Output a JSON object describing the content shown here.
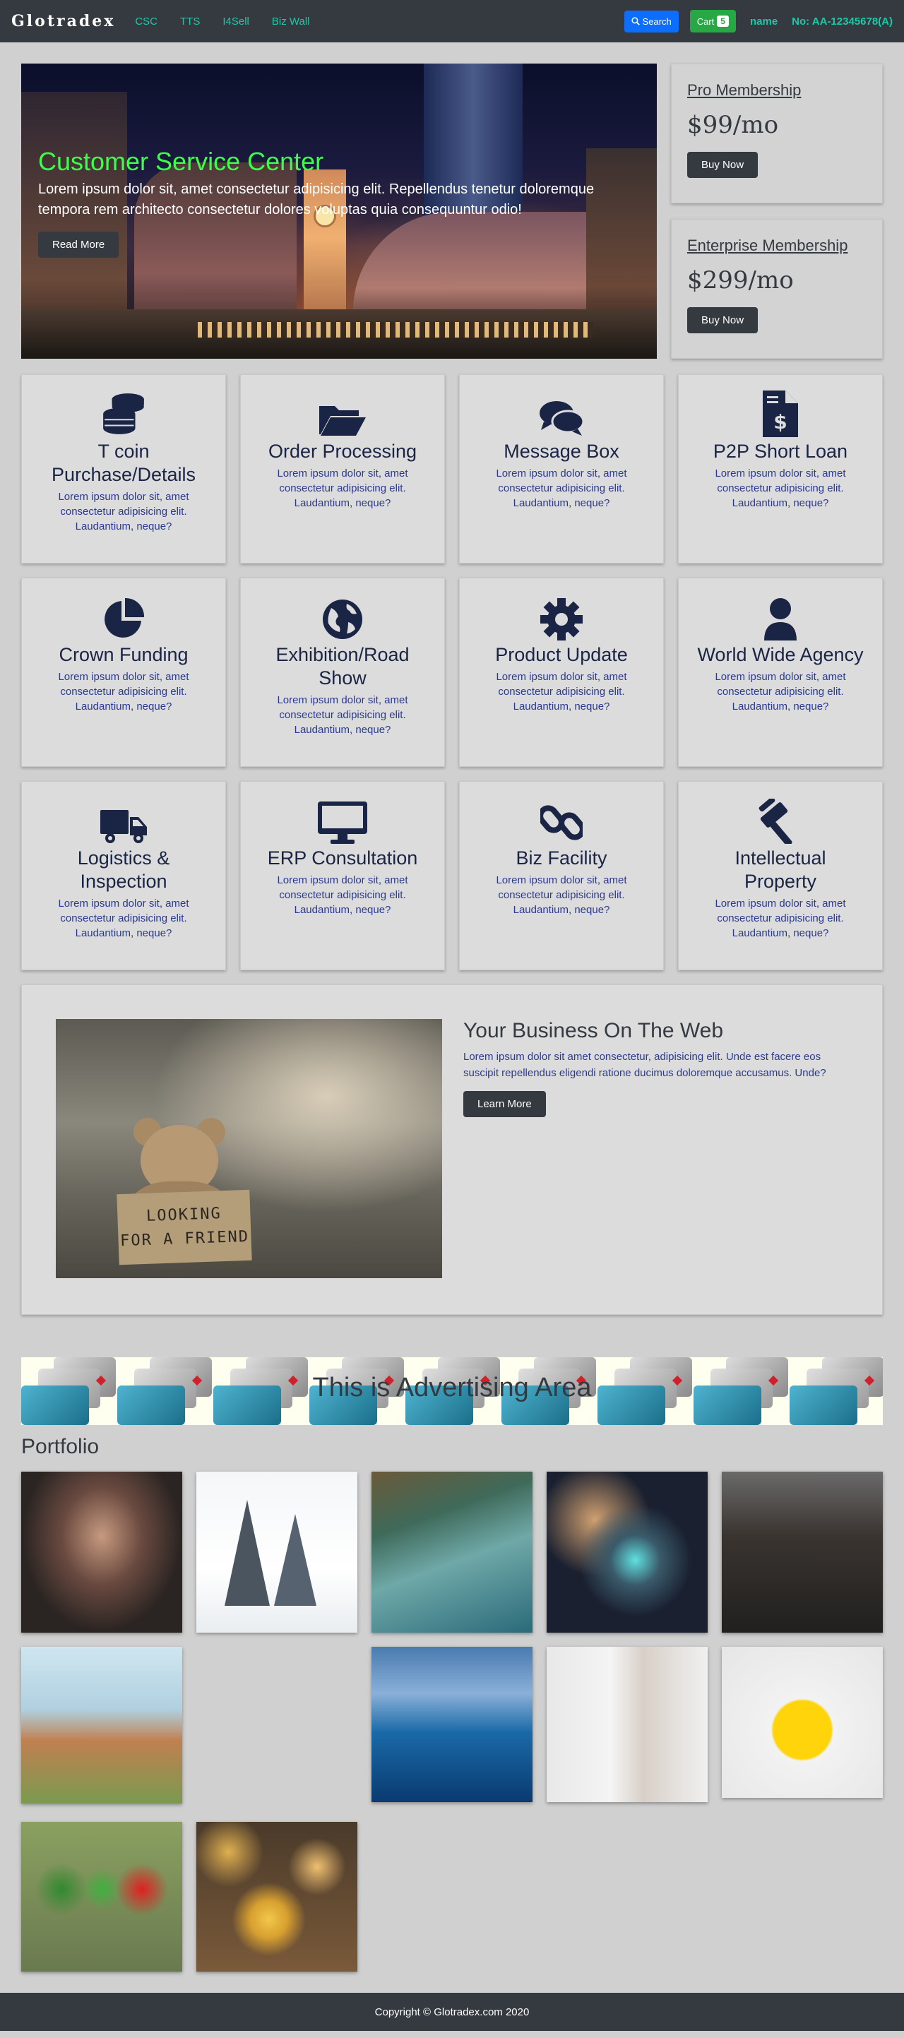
{
  "navbar": {
    "brand": "Glotradex",
    "links": [
      "CSC",
      "TTS",
      "I4Sell",
      "Biz Wall"
    ],
    "search_label": "Search",
    "cart_label": "Cart",
    "cart_count": "5",
    "user_name": "name",
    "account_no": "No: AA-12345678(A)"
  },
  "hero": {
    "title": "Customer Service Center",
    "text": "Lorem ipsum dolor sit, amet consectetur adipisicing elit. Repellendus tenetur doloremque tempora rem architecto consectetur dolores voluptas quia consequuntur odio!",
    "button_label": "Read More"
  },
  "memberships": [
    {
      "title": "Pro Membership",
      "price": "$99/mo",
      "button_label": "Buy Now"
    },
    {
      "title": "Enterprise Membership",
      "price": "$299/mo",
      "button_label": "Buy Now"
    }
  ],
  "services": [
    {
      "icon": "coins-icon",
      "title": "T coin Purchase/Details",
      "text": "Lorem ipsum dolor sit, amet consectetur adipisicing elit. Laudantium, neque?"
    },
    {
      "icon": "folder-open-icon",
      "title": "Order Processing",
      "text": "Lorem ipsum dolor sit, amet consectetur adipisicing elit. Laudantium, neque?"
    },
    {
      "icon": "comments-icon",
      "title": "Message Box",
      "text": "Lorem ipsum dolor sit, amet consectetur adipisicing elit. Laudantium, neque?"
    },
    {
      "icon": "invoice-dollar-icon",
      "title": "P2P Short Loan",
      "text": "Lorem ipsum dolor sit, amet consectetur adipisicing elit. Laudantium, neque?"
    },
    {
      "icon": "pie-chart-icon",
      "title": "Crown Funding",
      "text": "Lorem ipsum dolor sit, amet consectetur adipisicing elit. Laudantium, neque?"
    },
    {
      "icon": "globe-icon",
      "title": "Exhibition/Road Show",
      "text": "Lorem ipsum dolor sit, amet consectetur adipisicing elit. Laudantium, neque?"
    },
    {
      "icon": "cog-icon",
      "title": "Product Update",
      "text": "Lorem ipsum dolor sit, amet consectetur adipisicing elit. Laudantium, neque?"
    },
    {
      "icon": "user-icon",
      "title": "World Wide Agency",
      "text": "Lorem ipsum dolor sit, amet consectetur adipisicing elit. Laudantium, neque?"
    },
    {
      "icon": "truck-icon",
      "title": "Logistics & Inspection",
      "text": "Lorem ipsum dolor sit, amet consectetur adipisicing elit. Laudantium, neque?"
    },
    {
      "icon": "desktop-icon",
      "title": "ERP Consultation",
      "text": "Lorem ipsum dolor sit, amet consectetur adipisicing elit. Laudantium, neque?"
    },
    {
      "icon": "link-icon",
      "title": "Biz Facility",
      "text": "Lorem ipsum dolor sit, amet consectetur adipisicing elit. Laudantium, neque?"
    },
    {
      "icon": "gavel-icon",
      "title": "Intellectual Property",
      "text": "Lorem ipsum dolor sit, amet consectetur adipisicing elit. Laudantium, neque?"
    }
  ],
  "business": {
    "title": "Your Business On The Web",
    "text": "Lorem ipsum dolor sit amet consectetur, adipisicing elit. Unde est facere eos suscipit repellendus eligendi ratione ducimus doloremque accusamus. Unde?",
    "button_label": "Learn More",
    "image_sign_line1": "LOOKING",
    "image_sign_line2": "FOR A FRIEND"
  },
  "advert": {
    "text": "This is Advertising Area"
  },
  "portfolio": {
    "title": "Portfolio"
  },
  "footer": {
    "text": "Copyright © Glotradex.com 2020"
  },
  "colors": {
    "nav_bg": "#343a40",
    "nav_link": "#1ec8a8",
    "hero_title": "#3cff4a",
    "search_button": "#0d6efd",
    "cart_button": "#28a745",
    "icon": "#1a2444",
    "body_text": "#2b3a8f"
  }
}
